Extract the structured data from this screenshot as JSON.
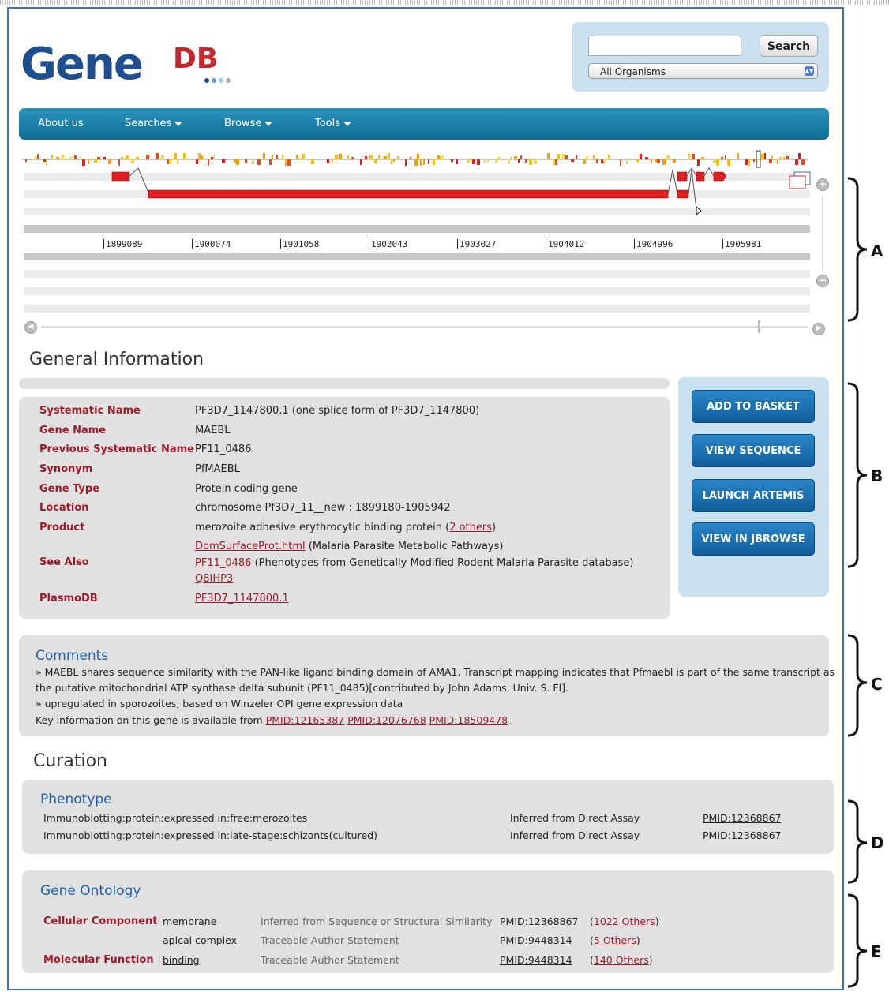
{
  "logo": {
    "text": "GeneDB"
  },
  "search": {
    "placeholder": "",
    "button": "Search",
    "organism": "All Organisms"
  },
  "nav": {
    "items": [
      "About us",
      "Searches",
      "Browse",
      "Tools"
    ]
  },
  "ruler": {
    "ticks": [
      "1899089",
      "1900074",
      "1901058",
      "1902043",
      "1903027",
      "1904012",
      "1904996",
      "1905981"
    ]
  },
  "braces": {
    "a": "A",
    "b": "B",
    "c": "C",
    "d": "D",
    "e": "E"
  },
  "general": {
    "title": "General Information",
    "fields": [
      {
        "label": "Systematic Name",
        "value": "PF3D7_1147800.1 (one splice form of PF3D7_1147800)"
      },
      {
        "label": "Gene Name",
        "value": "MAEBL"
      },
      {
        "label": "Previous Systematic Name",
        "value": "PF11_0486"
      },
      {
        "label": "Synonym",
        "value": "PfMAEBL"
      },
      {
        "label": "Gene Type",
        "value": "Protein coding gene"
      },
      {
        "label": "Location",
        "value": "chromosome Pf3D7_11__new : 1899180-1905942"
      },
      {
        "label": "Product",
        "value": "merozoite adhesive erythrocytic binding protein (",
        "link": "2 others",
        "after": ")"
      }
    ],
    "see_also": {
      "label": "See Also",
      "items": [
        {
          "link": "DomSurfaceProt.html",
          "text": " (Malaria Parasite Metabolic Pathways)"
        },
        {
          "link": "PF11_0486",
          "text": " (Phenotypes from Genetically Modified Rodent Malaria Parasite database)"
        },
        {
          "link": "Q8IHP3",
          "text": ""
        }
      ]
    },
    "plasmodb": {
      "label": "PlasmoDB",
      "link": "PF3D7_1147800.1"
    }
  },
  "actions": {
    "add": "ADD TO BASKET",
    "sequence": "VIEW SEQUENCE",
    "artemis": "LAUNCH ARTEMIS",
    "jbrowse": "VIEW IN JBROWSE"
  },
  "comments": {
    "title": "Comments",
    "line1": "» MAEBL shares sequence similarity with the PAN-like ligand binding domain of AMA1. Transcript mapping indicates that Pfmaebl is part of the same transcript as",
    "line2": "the putative mitochondrial ATP synthase delta subunit (PF11_0485)[contributed by John Adams, Univ. S. Fl].",
    "line3": "» upregulated in sporozoites, based on Winzeler OPI gene expression data",
    "key_prefix": "Key information on this gene is available from",
    "pmids": [
      "PMID:12165387",
      "PMID:12076768",
      "PMID:18509478"
    ]
  },
  "curation": {
    "title": "Curation"
  },
  "phenotype": {
    "title": "Phenotype",
    "rows": [
      {
        "term": "Immunoblotting:protein:expressed in:free:merozoites",
        "evidence": "Inferred from Direct Assay",
        "pmid": "PMID:12368867"
      },
      {
        "term": "Immunoblotting:protein:expressed in:late-stage:schizonts(cultured)",
        "evidence": "Inferred from Direct Assay",
        "pmid": "PMID:12368867"
      }
    ]
  },
  "go": {
    "title": "Gene Ontology",
    "rows": [
      {
        "category": "Cellular Component",
        "term": "membrane",
        "evidence": "Inferred from Sequence or Structural Similarity",
        "pmid": "PMID:12368867",
        "others": "1022 Others"
      },
      {
        "category": "",
        "term": "apical complex",
        "evidence": "Traceable Author Statement",
        "pmid": "PMID:9448314",
        "others": "5 Others"
      },
      {
        "category": "Molecular Function",
        "term": "binding",
        "evidence": "Traceable Author Statement",
        "pmid": "PMID:9448314",
        "others": "140 Others"
      }
    ]
  }
}
